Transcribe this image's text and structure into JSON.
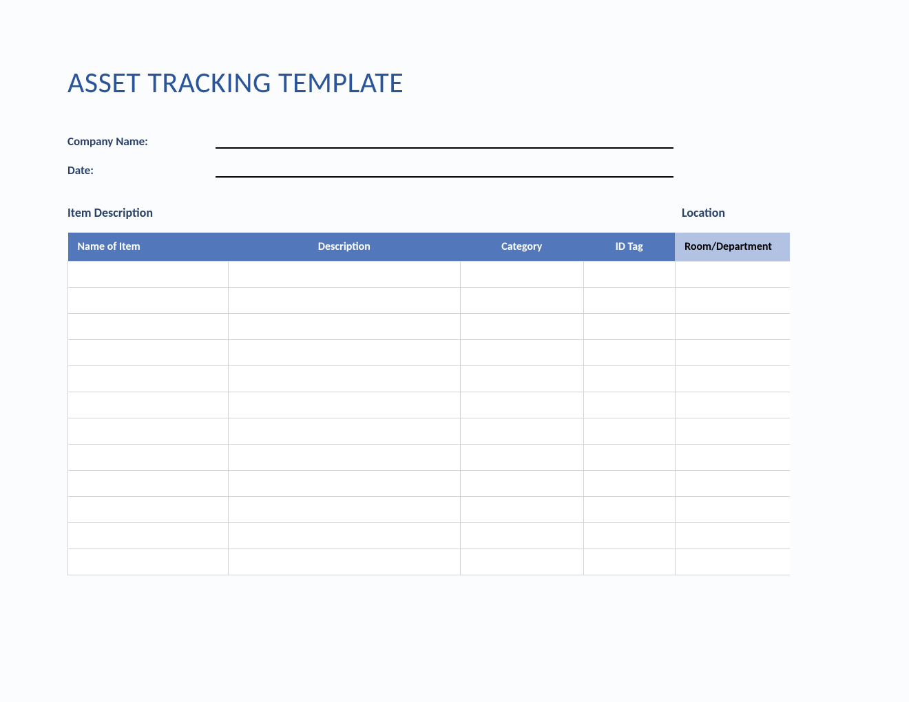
{
  "title": "ASSET TRACKING TEMPLATE",
  "form": {
    "company_label": "Company Name:",
    "date_label": "Date:"
  },
  "sections": {
    "item_description": "Item Description",
    "location": "Location"
  },
  "table": {
    "headers": {
      "name": "Name of Item",
      "description": "Description",
      "category": "Category",
      "id_tag": "ID Tag",
      "room": "Room/Department"
    },
    "rows": [
      {
        "name": "",
        "description": "",
        "category": "",
        "id_tag": "",
        "room": ""
      },
      {
        "name": "",
        "description": "",
        "category": "",
        "id_tag": "",
        "room": ""
      },
      {
        "name": "",
        "description": "",
        "category": "",
        "id_tag": "",
        "room": ""
      },
      {
        "name": "",
        "description": "",
        "category": "",
        "id_tag": "",
        "room": ""
      },
      {
        "name": "",
        "description": "",
        "category": "",
        "id_tag": "",
        "room": ""
      },
      {
        "name": "",
        "description": "",
        "category": "",
        "id_tag": "",
        "room": ""
      },
      {
        "name": "",
        "description": "",
        "category": "",
        "id_tag": "",
        "room": ""
      },
      {
        "name": "",
        "description": "",
        "category": "",
        "id_tag": "",
        "room": ""
      },
      {
        "name": "",
        "description": "",
        "category": "",
        "id_tag": "",
        "room": ""
      },
      {
        "name": "",
        "description": "",
        "category": "",
        "id_tag": "",
        "room": ""
      },
      {
        "name": "",
        "description": "",
        "category": "",
        "id_tag": "",
        "room": ""
      },
      {
        "name": "",
        "description": "",
        "category": "",
        "id_tag": "",
        "room": ""
      }
    ]
  }
}
